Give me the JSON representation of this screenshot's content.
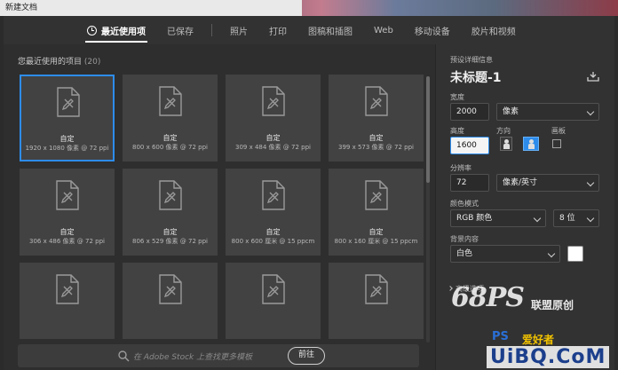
{
  "window": {
    "title": "新建文档"
  },
  "tabs": [
    {
      "label": "最近使用项",
      "active": true
    },
    {
      "label": "已保存"
    },
    {
      "label": "照片"
    },
    {
      "label": "打印"
    },
    {
      "label": "图稿和插图"
    },
    {
      "label": "Web"
    },
    {
      "label": "移动设备"
    },
    {
      "label": "胶片和视频"
    }
  ],
  "recent": {
    "title": "您最近使用的项目",
    "count": "(20)",
    "items": [
      {
        "name": "自定",
        "size": "1920 x 1080 像素 @ 72 ppi",
        "selected": true
      },
      {
        "name": "自定",
        "size": "800 x 600 像素 @ 72 ppi"
      },
      {
        "name": "自定",
        "size": "309 x 484 像素 @ 72 ppi"
      },
      {
        "name": "自定",
        "size": "399 x 573 像素 @ 72 ppi"
      },
      {
        "name": "自定",
        "size": "306 x 486 像素 @ 72 ppi"
      },
      {
        "name": "自定",
        "size": "806 x 529 像素 @ 72 ppi"
      },
      {
        "name": "自定",
        "size": "800 x 600 厘米 @ 15 ppcm"
      },
      {
        "name": "自定",
        "size": "800 x 160 厘米 @ 15 ppcm"
      },
      {
        "name": "",
        "size": ""
      },
      {
        "name": "",
        "size": ""
      },
      {
        "name": "",
        "size": ""
      },
      {
        "name": "",
        "size": ""
      }
    ]
  },
  "stock": {
    "placeholder": "在 Adobe Stock 上查找更多模板",
    "go_label": "前往"
  },
  "preset": {
    "section": "预设详细信息",
    "doc_title": "未标题-1",
    "width_label": "宽度",
    "width_value": "2000",
    "width_unit": "像素",
    "height_label": "高度",
    "height_value": "1600",
    "orientation_label": "方向",
    "artboard_label": "画板",
    "resolution_label": "分辨率",
    "resolution_value": "72",
    "resolution_unit": "像素/英寸",
    "color_mode_label": "颜色模式",
    "color_mode_value": "RGB 颜色",
    "bit_depth": "8 位",
    "background_label": "背景内容",
    "background_value": "白色",
    "background_color": "#ffffff",
    "advanced_label": "高级选项"
  },
  "watermarks": {
    "logo_text": "68PS",
    "logo_sub": "联盟原创",
    "site_a": "PS",
    "site_b": "爱好者",
    "site_c": "UiBQ.CoM"
  },
  "colors": {
    "accent": "#2d8ceb"
  }
}
